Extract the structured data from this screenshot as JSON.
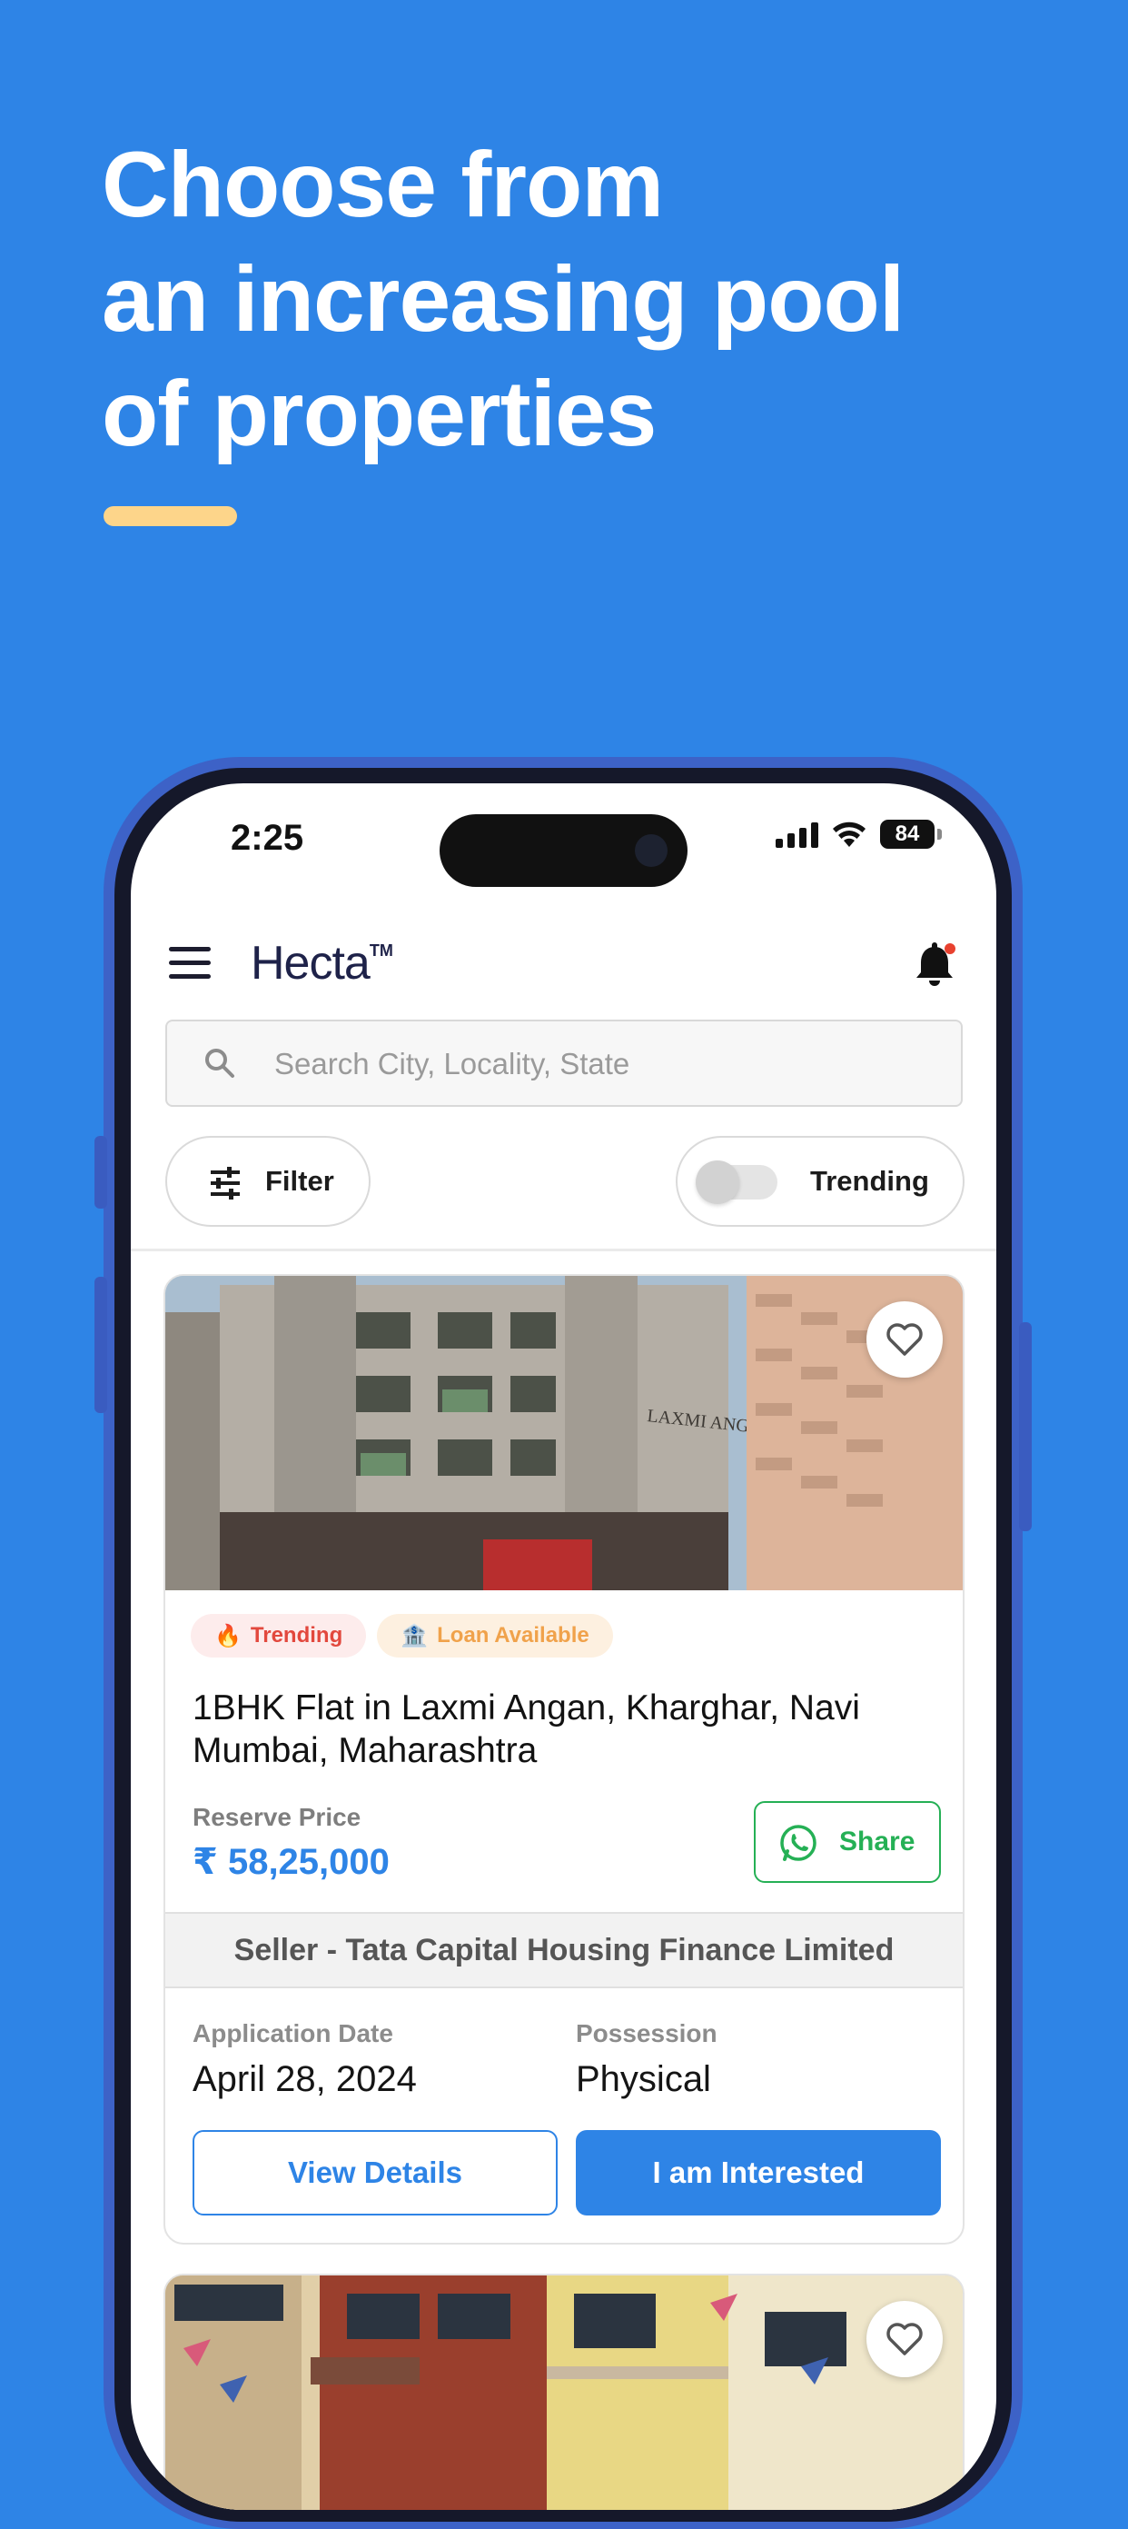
{
  "headline": {
    "line1": "Choose from",
    "line2": "an increasing pool",
    "line3": "of properties"
  },
  "colors": {
    "background": "#2E84E6",
    "accent_bar": "#FDD58A",
    "primary": "#2E84E6",
    "whatsapp_green": "#25B055",
    "trending_red": "#E2483D",
    "loan_orange": "#F0A24B"
  },
  "status_bar": {
    "time": "2:25",
    "battery": "84",
    "icons": [
      "signal-icon",
      "wifi-icon",
      "battery-icon"
    ]
  },
  "app_header": {
    "logo": "Hecta",
    "logo_mark": "TM",
    "icons": [
      "menu-icon",
      "bell-icon"
    ],
    "has_notification": true
  },
  "search": {
    "placeholder": "Search City, Locality, State"
  },
  "filters": {
    "filter_label": "Filter",
    "trending_label": "Trending",
    "trending_enabled": false
  },
  "listing": {
    "badges": [
      "Trending",
      "Loan Available"
    ],
    "title": "1BHK Flat in Laxmi Angan, Kharghar, Navi Mumbai, Maharashtra",
    "photo_sign": "LAXMI ANGAN",
    "price_label": "Reserve Price",
    "price_value": "₹ 58,25,000",
    "share_label": "Share",
    "seller": "Seller - Tata Capital Housing Finance Limited",
    "application_date_label": "Application Date",
    "application_date": "April 28, 2024",
    "possession_label": "Possession",
    "possession": "Physical",
    "view_details_label": "View Details",
    "interested_label": "I am Interested"
  }
}
